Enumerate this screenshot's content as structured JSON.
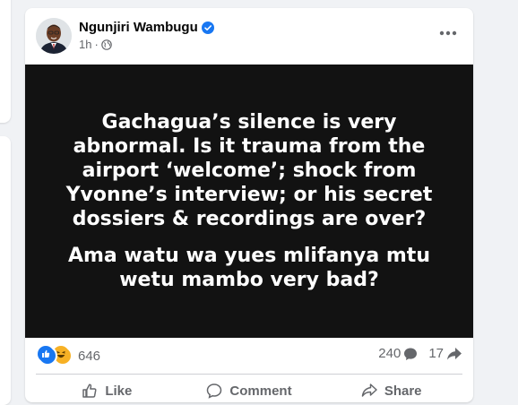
{
  "post": {
    "author": "Ngunjiri Wambugu",
    "time": "1h",
    "separator": "·",
    "text_line1": "Gachagua’s silence is very abnormal. Is it trauma from the airport ‘welcome’; shock from Yvonne’s interview; or his secret dossiers & recordings are over?",
    "text_line2": "Ama watu wa yues mlifanya mtu wetu mambo very bad?",
    "reaction_count": "646",
    "comment_count": "240",
    "share_count": "17"
  },
  "actions": {
    "like": "Like",
    "comment": "Comment",
    "share": "Share"
  },
  "icons": {
    "verified": "verified-badge-icon",
    "globe": "globe-icon",
    "more": "more-options-icon"
  },
  "colors": {
    "accent": "#1877f2",
    "media_bg": "#121212",
    "secondary_text": "#65676b"
  }
}
